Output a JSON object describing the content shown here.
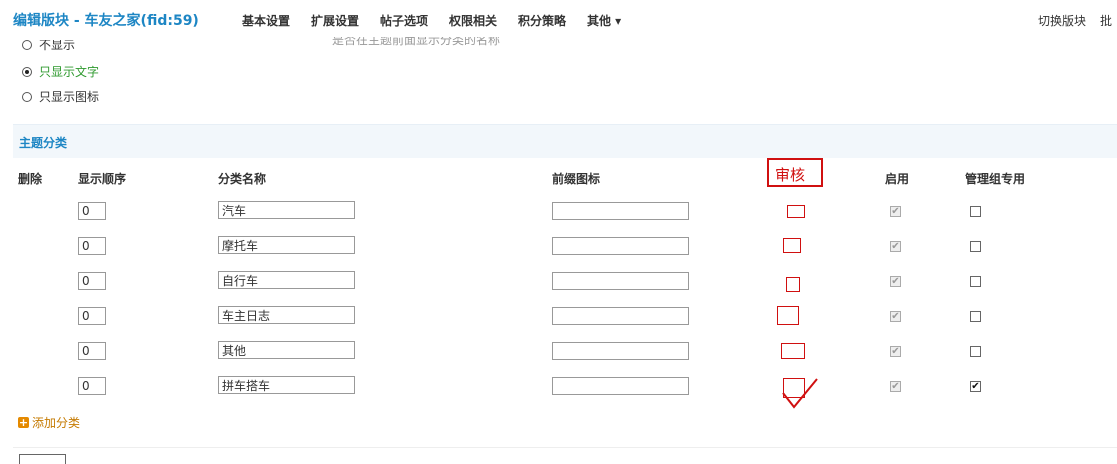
{
  "header": {
    "title": "编辑版块 - 车友之家(fid:59)",
    "nav": [
      "基本设置",
      "扩展设置",
      "帖子选项",
      "权限相关",
      "积分策略",
      "其他 ▾"
    ],
    "switch_label": "切换版块",
    "batch_label": "批"
  },
  "display_options": {
    "hint": "是否在主题前面显示分类的名称",
    "options": [
      {
        "label": "不显示",
        "selected": false
      },
      {
        "label": "只显示文字",
        "selected": true
      },
      {
        "label": "只显示图标",
        "selected": false
      }
    ]
  },
  "section": {
    "title": "主题分类",
    "headers": {
      "delete": "删除",
      "order": "显示顺序",
      "name": "分类名称",
      "icon": "前缀图标",
      "enable": "启用",
      "admin_only": "管理组专用"
    },
    "review_annotation": "审核"
  },
  "rows": [
    {
      "order": "0",
      "name": "汽车",
      "icon": "",
      "enabled": true,
      "admin_only": false
    },
    {
      "order": "0",
      "name": "摩托车",
      "icon": "",
      "enabled": true,
      "admin_only": false
    },
    {
      "order": "0",
      "name": "自行车",
      "icon": "",
      "enabled": true,
      "admin_only": false
    },
    {
      "order": "0",
      "name": "车主日志",
      "icon": "",
      "enabled": true,
      "admin_only": false
    },
    {
      "order": "0",
      "name": "其他",
      "icon": "",
      "enabled": true,
      "admin_only": false
    },
    {
      "order": "0",
      "name": "拼车搭车",
      "icon": "",
      "enabled": true,
      "admin_only": true
    }
  ],
  "add_category_label": "添加分类",
  "colors": {
    "accent": "#1d86c4",
    "annotation": "#d01010",
    "add_link": "#c57a00"
  }
}
